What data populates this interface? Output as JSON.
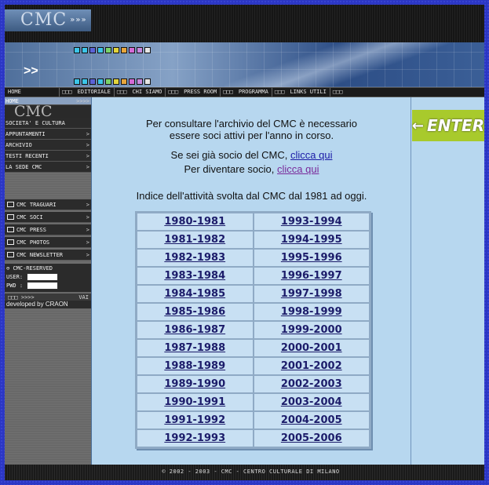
{
  "header": {
    "logo": "CMC",
    "logo_arrows": "»»»",
    "banner_arrows": ">>"
  },
  "nav": {
    "items": [
      "HOME",
      "EDITORIALE",
      "CHI SIAMO",
      "PRESS ROOM",
      "PROGRAMMA",
      "LINKS UTILI"
    ],
    "separator": "□□□"
  },
  "sidebar": {
    "home": "HOME",
    "home_arrows": ">>>>",
    "logo": "CMC",
    "menu": [
      "SOCIETA' E CULTURA",
      "APPUNTAMENTI",
      "ARCHIVIO",
      "TESTI RECENTI",
      "LA SEDE CMC"
    ],
    "cmc_menu": [
      "CMC TRAGUARI",
      "CMC SOCI",
      "CMC PRESS",
      "CMC PHOTOS",
      "CMC NEWSLETTER"
    ],
    "chevron": ">",
    "reserved_title": "CMC-RESERVED",
    "user_label": "USER:",
    "pwd_label": "PWD :",
    "vai_arrows": "□□□ >>>> ",
    "vai_label": "VAI",
    "credit": "developed by CRAON"
  },
  "main": {
    "intro": "Per consultare l'archivio del CMC è necessario essere soci attivi per l'anno in corso.",
    "socio_text": "Se sei già socio del CMC, ",
    "socio_link": "clicca qui",
    "diventare_text": "Per diventare socio, ",
    "diventare_link": "clicca qui",
    "index_title": "Indice dell'attività svolta dal CMC dal 1981 ad oggi.",
    "years_left": [
      "1980-1981",
      "1981-1982",
      "1982-1983",
      "1983-1984",
      "1984-1985",
      "1985-1986",
      "1986-1987",
      "1987-1988",
      "1988-1989",
      "1989-1990",
      "1990-1991",
      "1991-1992",
      "1992-1993"
    ],
    "years_right": [
      "1993-1994",
      "1994-1995",
      "1995-1996",
      "1996-1997",
      "1997-1998",
      "1998-1999",
      "1999-2000",
      "2000-2001",
      "2001-2002",
      "2002-2003",
      "2003-2004",
      "2004-2005",
      "2005-2006"
    ]
  },
  "right": {
    "enter_arrow": "←",
    "enter_label": "ENTER"
  },
  "footer": {
    "text": "© 2002 - 2003 - CMC - CENTRO CULTURALE DI MILANO"
  },
  "colors": {
    "page_bg": "#2b36c4",
    "content_bg": "#b7d7ef",
    "enter_bg": "#a8ca2c",
    "link": "#1a1aa6",
    "visited_link": "#7a2a9a"
  }
}
